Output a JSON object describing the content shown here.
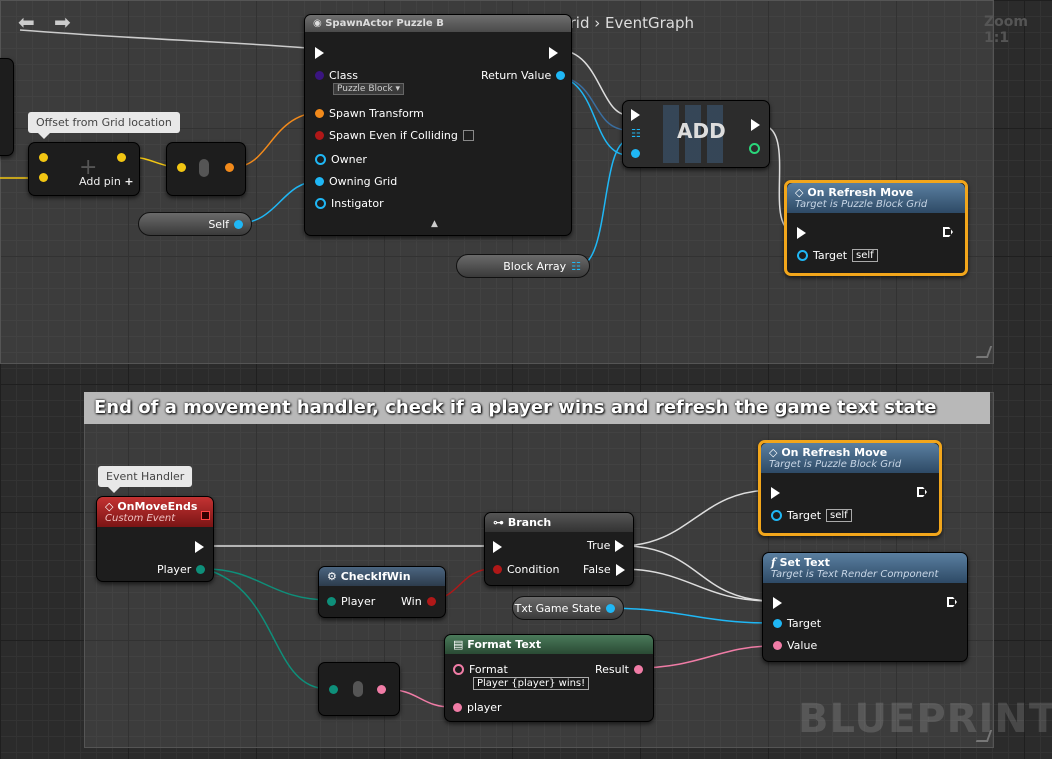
{
  "breadcrumb": {
    "blueprint": "PuzzleBlockGrid",
    "separator": "›",
    "graph": "EventGraph"
  },
  "zoom_label": "Zoom 1:1",
  "watermark": "BLUEPRINT",
  "comment2_title": "End of a movement handler, check if a player wins and refresh the game text state",
  "bubbles": {
    "offset": "Offset from Grid location",
    "event_handler": "Event Handler"
  },
  "spawn_node": {
    "title": "SpawnActor Puzzle B",
    "class_label": "Class",
    "class_value": "Puzzle Block",
    "return_label": "Return Value",
    "spawn_transform": "Spawn Transform",
    "spawn_colliding": "Spawn Even if Colliding",
    "owner": "Owner",
    "owning_grid": "Owning Grid",
    "instigator": "Instigator"
  },
  "add_pin_node": {
    "label": "Add pin"
  },
  "self_pill": "Self",
  "block_array_pill": "Block Array",
  "add_node": {
    "label": "ADD"
  },
  "refresh1": {
    "title": "On Refresh Move",
    "subtitle": "Target is Puzzle Block Grid",
    "target_label": "Target",
    "target_value": "self"
  },
  "refresh2": {
    "title": "On Refresh Move",
    "subtitle": "Target is Puzzle Block Grid",
    "target_label": "Target",
    "target_value": "self"
  },
  "on_move_ends": {
    "title": "OnMoveEnds",
    "subtitle": "Custom Event",
    "player_label": "Player"
  },
  "branch": {
    "title": "Branch",
    "condition": "Condition",
    "true_label": "True",
    "false_label": "False"
  },
  "check_win": {
    "title": "CheckIfWin",
    "player": "Player",
    "win": "Win"
  },
  "txt_game_state_pill": "Txt Game State",
  "set_text": {
    "title": "Set Text",
    "subtitle": "Target is Text Render Component",
    "target": "Target",
    "value": "Value"
  },
  "format_text": {
    "title": "Format Text",
    "format_label": "Format",
    "format_value": "Player {player} wins!",
    "result": "Result",
    "player": "player"
  },
  "colors": {
    "exec": "#ffffff",
    "object": "#1fb7f5",
    "vector": "#f2c613",
    "transform": "#f28a1b",
    "bool": "#b01818",
    "struct": "#0e8f7a",
    "text": "#f07ca6",
    "selected": "#f2a61b"
  }
}
